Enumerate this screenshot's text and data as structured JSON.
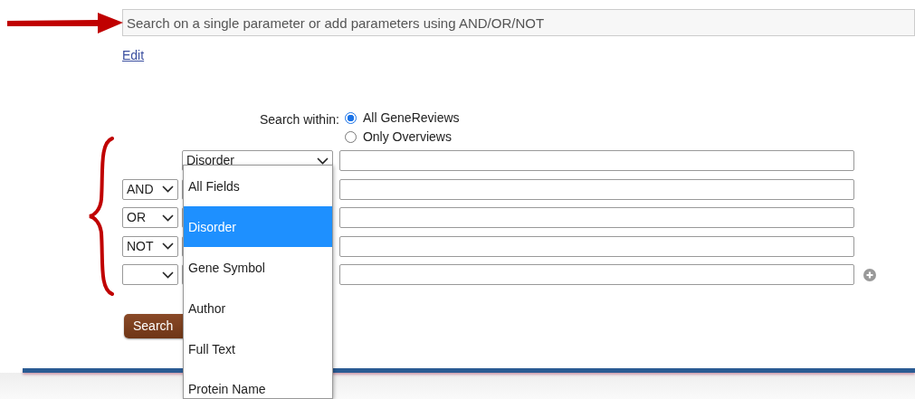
{
  "query_box": {
    "placeholder": "Search on a single parameter or add parameters using AND/OR/NOT"
  },
  "edit_link": "Edit",
  "search_within": {
    "label": "Search within:",
    "options": [
      {
        "label": "All GeneReviews",
        "selected": true
      },
      {
        "label": "Only Overviews",
        "selected": false
      }
    ]
  },
  "rows": [
    {
      "kind": "first",
      "field": "Disorder"
    },
    {
      "kind": "operator",
      "operator": "AND"
    },
    {
      "kind": "operator",
      "operator": "OR"
    },
    {
      "kind": "operator",
      "operator": "NOT"
    },
    {
      "kind": "blank"
    }
  ],
  "dropdown": {
    "options": [
      {
        "label": "All Fields",
        "selected": false
      },
      {
        "label": "Disorder",
        "selected": true
      },
      {
        "label": "Gene Symbol",
        "selected": false
      },
      {
        "label": "Author",
        "selected": false
      },
      {
        "label": "Full Text",
        "selected": false
      },
      {
        "label": "Protein Name",
        "selected": false
      }
    ]
  },
  "search_button": "Search"
}
